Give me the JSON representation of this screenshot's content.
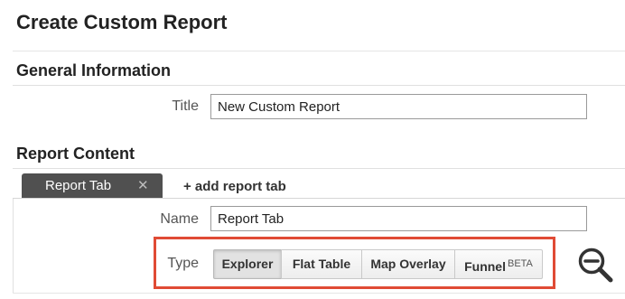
{
  "page": {
    "title": "Create Custom Report"
  },
  "general_information": {
    "heading": "General Information",
    "title_label": "Title",
    "title_value": "New Custom Report"
  },
  "report_content": {
    "heading": "Report Content",
    "tabs": [
      {
        "label": "Report Tab",
        "close_glyph": "✕"
      }
    ],
    "add_tab_label": "+ add report tab",
    "name_label": "Name",
    "name_value": "Report Tab",
    "type_label": "Type",
    "type_options": [
      {
        "label": "Explorer",
        "selected": true
      },
      {
        "label": "Flat Table",
        "selected": false
      },
      {
        "label": "Map Overlay",
        "selected": false
      },
      {
        "label": "Funnel",
        "badge": "BETA",
        "selected": false
      }
    ]
  },
  "icons": {
    "zoom": "zoom-out-icon"
  },
  "colors": {
    "highlight_border": "#e04b35",
    "active_tab_bg": "#505050"
  }
}
